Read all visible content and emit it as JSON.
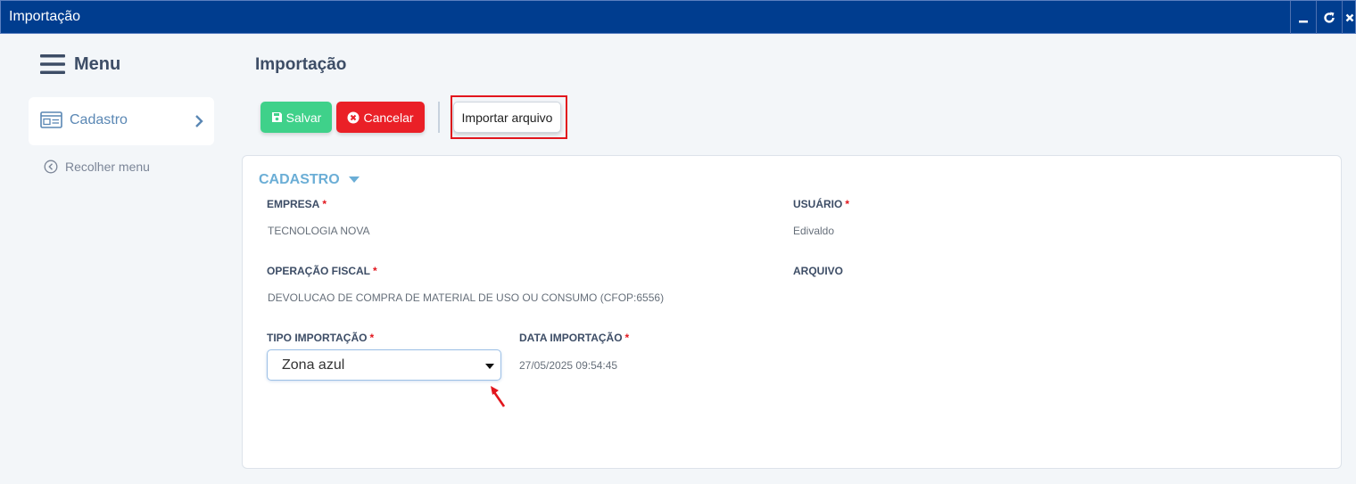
{
  "window": {
    "title": "Importação",
    "controls": [
      {
        "name": "minimize",
        "icon": "minimize-icon"
      },
      {
        "name": "refresh",
        "icon": "refresh-icon"
      },
      {
        "name": "close",
        "icon": "close-icon"
      }
    ]
  },
  "sidebar": {
    "title": "Menu",
    "items": [
      {
        "label": "Cadastro",
        "icon": "form-card-icon"
      }
    ],
    "collapse_label": "Recolher menu"
  },
  "main": {
    "title": "Importação",
    "toolbar": {
      "save_label": "Salvar",
      "cancel_label": "Cancelar",
      "import_label": "Importar arquivo"
    },
    "section": {
      "title": "CADASTRO",
      "fields": {
        "empresa": {
          "label": "EMPRESA",
          "required": "*",
          "value": "TECNOLOGIA NOVA"
        },
        "usuario": {
          "label": "USUÁRIO",
          "required": "*",
          "value": "Edivaldo"
        },
        "operacao": {
          "label": "OPERAÇÃO FISCAL",
          "required": "*",
          "value": "DEVOLUCAO DE COMPRA DE MATERIAL DE USO OU CONSUMO (CFOP:6556)"
        },
        "arquivo": {
          "label": "ARQUIVO"
        },
        "tipo": {
          "label": "TIPO IMPORTAÇÃO",
          "required": "*",
          "value": "Zona azul"
        },
        "data": {
          "label": "DATA IMPORTAÇÃO",
          "required": "*",
          "value": "27/05/2025 09:54:45"
        }
      }
    }
  },
  "colors": {
    "titlebar": "#003d8f",
    "save": "#3fd18a",
    "cancel": "#ea2027",
    "accent": "#6baed6",
    "highlight": "#e2161d"
  }
}
